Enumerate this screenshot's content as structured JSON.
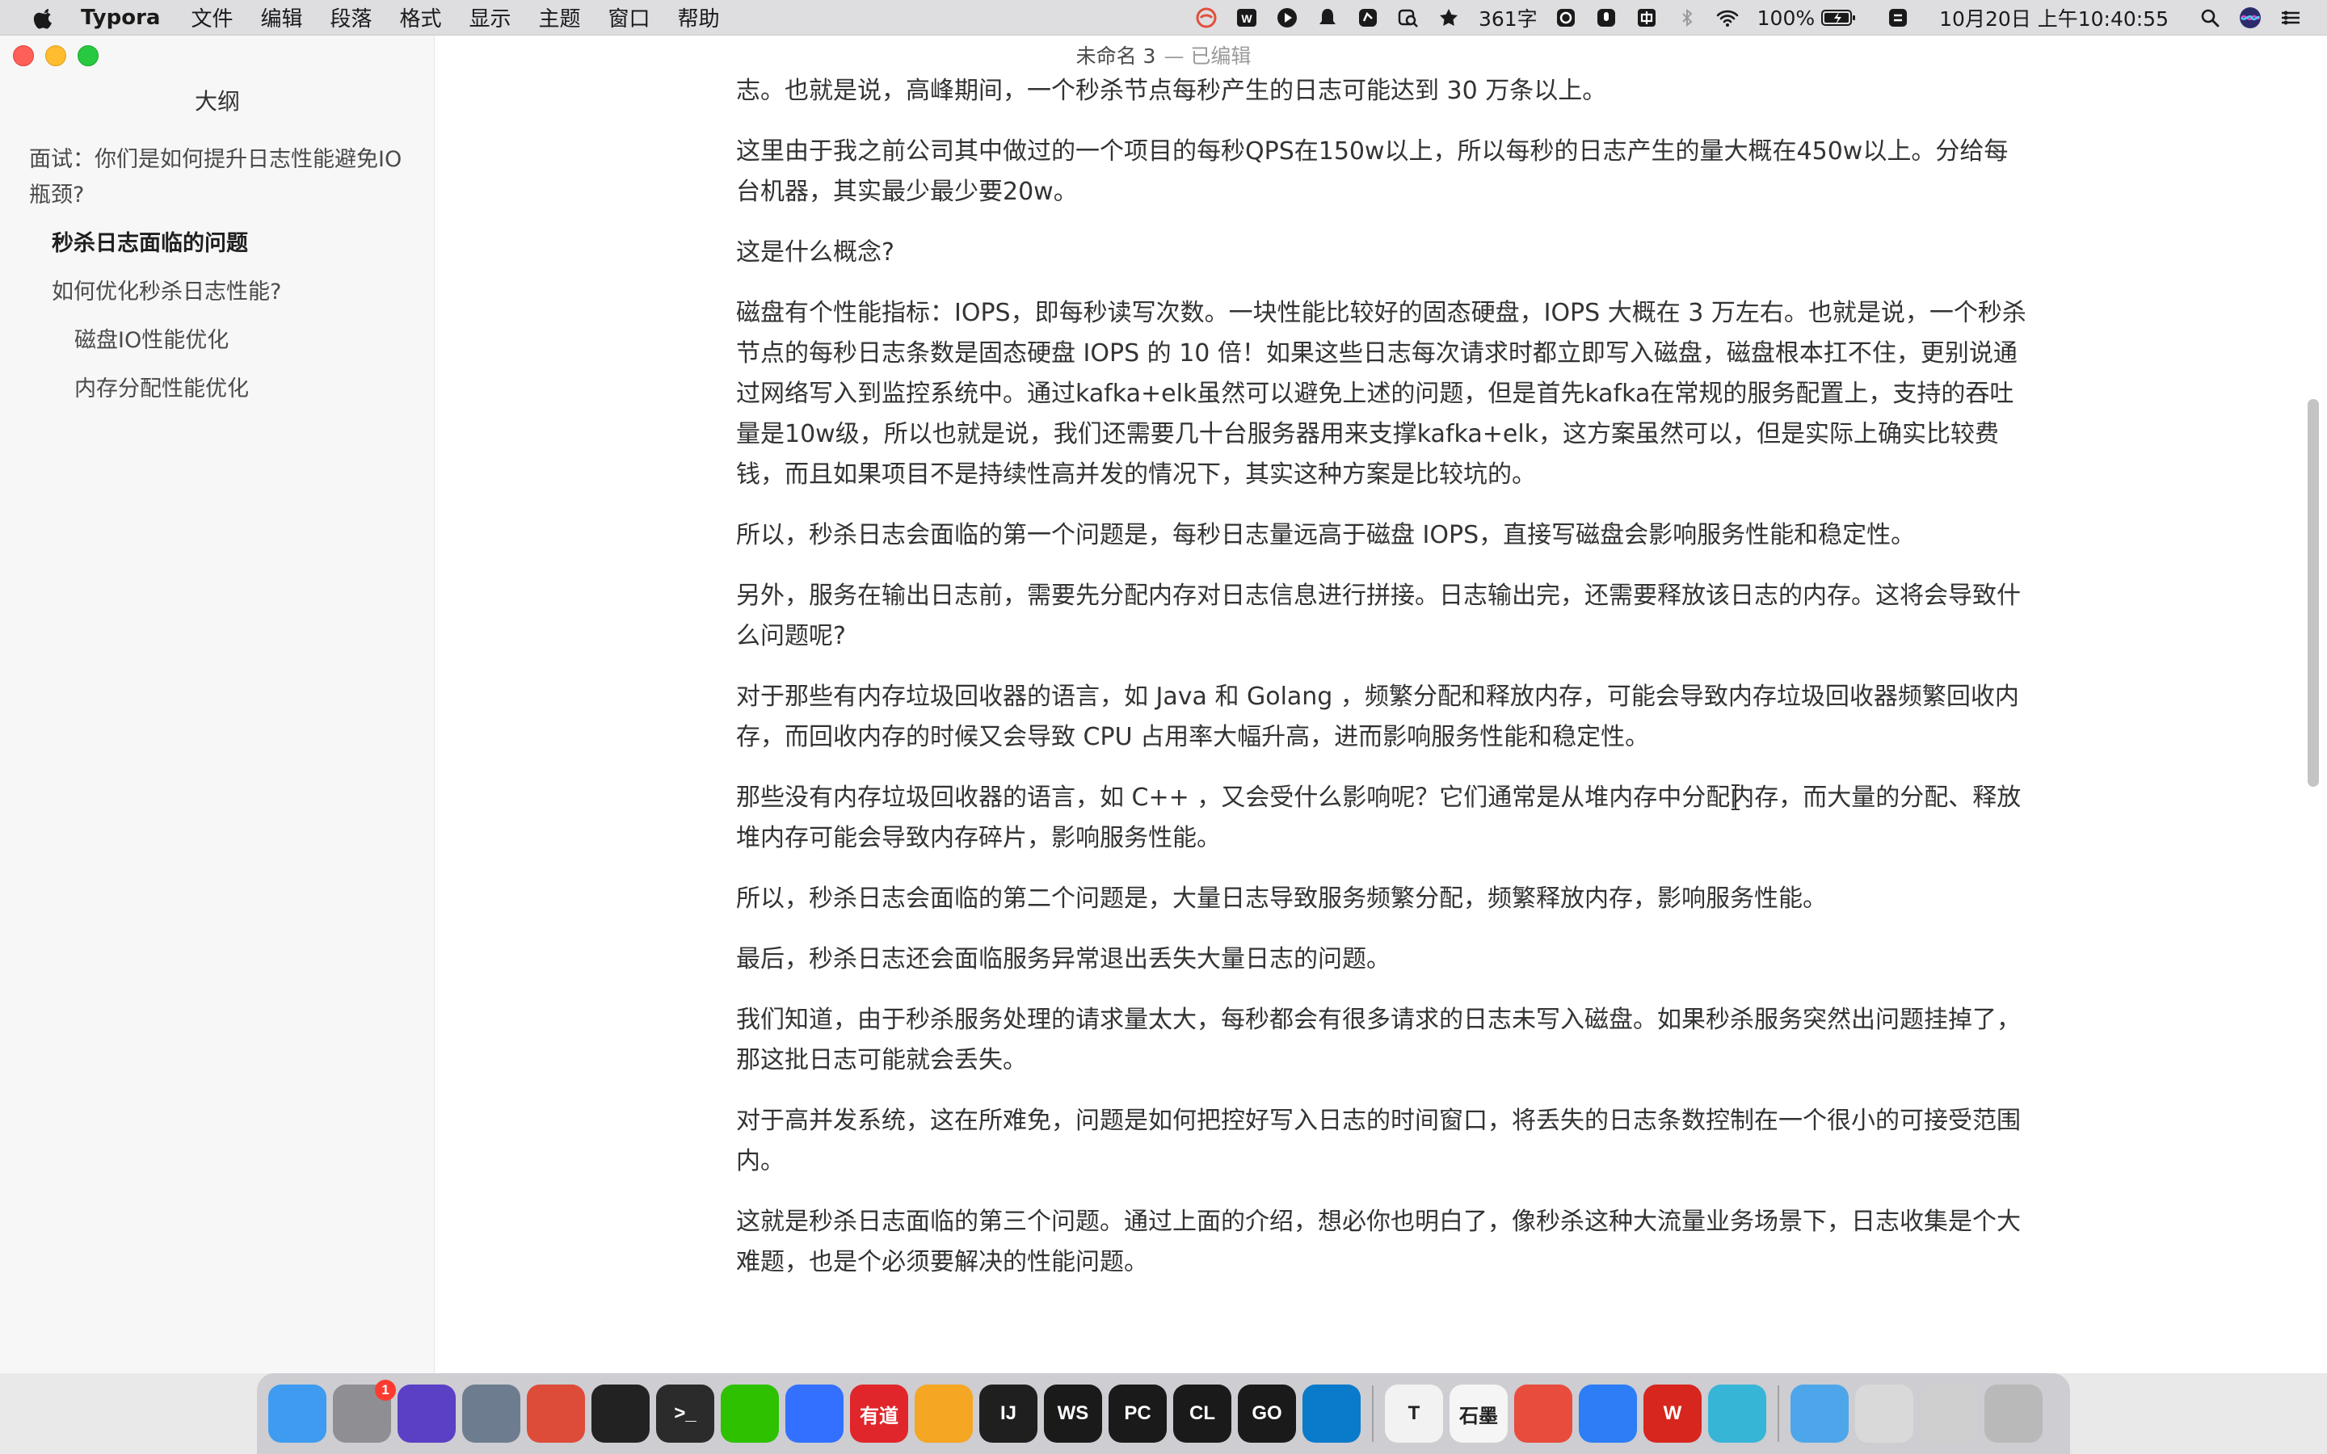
{
  "menubar": {
    "app_name": "Typora",
    "items": [
      "文件",
      "编辑",
      "段落",
      "格式",
      "显示",
      "主题",
      "窗口",
      "帮助"
    ],
    "status": {
      "word_count": "361字",
      "battery": "100%",
      "datetime": "10月20日 上午10:40:55"
    },
    "status_icons": [
      "typora-icon",
      "wps-icon",
      "play-icon",
      "qq-bell-icon",
      "screenshot-icon",
      "search-doc-icon",
      "star-icon",
      "wechat-icon",
      "mic-icon",
      "input-method-icon",
      "bluetooth-icon",
      "wifi-icon",
      "battery-icon",
      "sync-icon",
      "spotlight-icon",
      "siri-icon",
      "control-center-icon"
    ]
  },
  "window": {
    "title": "未命名 3",
    "status": "— 已编辑"
  },
  "sidebar": {
    "heading": "大纲",
    "outline": [
      {
        "label": "面试：你们是如何提升日志性能避免IO 瓶颈?",
        "level": 1,
        "active": false
      },
      {
        "label": "秒杀日志面临的问题",
        "level": 2,
        "active": true
      },
      {
        "label": "如何优化秒杀日志性能?",
        "level": 2,
        "active": false
      },
      {
        "label": "磁盘IO性能优化",
        "level": 3,
        "active": false
      },
      {
        "label": "内存分配性能优化",
        "level": 3,
        "active": false
      }
    ]
  },
  "document": {
    "paragraphs": [
      "志。也就是说，高峰期间，一个秒杀节点每秒产生的日志可能达到 30 万条以上。",
      "这里由于我之前公司其中做过的一个项目的每秒QPS在150w以上，所以每秒的日志产生的量大概在450w以上。分给每台机器，其实最少最少要20w。",
      "这是什么概念?",
      "磁盘有个性能指标：IOPS，即每秒读写次数。一块性能比较好的固态硬盘，IOPS 大概在 3 万左右。也就是说，一个秒杀节点的每秒日志条数是固态硬盘 IOPS 的 10 倍！如果这些日志每次请求时都立即写入磁盘，磁盘根本扛不住，更别说通过网络写入到监控系统中。通过kafka+elk虽然可以避免上述的问题，但是首先kafka在常规的服务配置上，支持的吞吐量是10w级，所以也就是说，我们还需要几十台服务器用来支撑kafka+elk，这方案虽然可以，但是实际上确实比较费钱，而且如果项目不是持续性高并发的情况下，其实这种方案是比较坑的。",
      "所以，秒杀日志会面临的第一个问题是，每秒日志量远高于磁盘 IOPS，直接写磁盘会影响服务性能和稳定性。",
      "另外，服务在输出日志前，需要先分配内存对日志信息进行拼接。日志输出完，还需要释放该日志的内存。这将会导致什么问题呢?",
      "对于那些有内存垃圾回收器的语言，如 Java 和 Golang ，频繁分配和释放内存，可能会导致内存垃圾回收器频繁回收内存，而回收内存的时候又会导致 CPU 占用率大幅升高，进而影响服务性能和稳定性。",
      "那些没有内存垃圾回收器的语言，如 C++ ，又会受什么影响呢？它们通常是从堆内存中分配内存，而大量的分配、释放堆内存可能会导致内存碎片，影响服务性能。",
      "所以，秒杀日志会面临的第二个问题是，大量日志导致服务频繁分配，频繁释放内存，影响服务性能。",
      "最后，秒杀日志还会面临服务异常退出丢失大量日志的问题。",
      "我们知道，由于秒杀服务处理的请求量太大，每秒都会有很多请求的日志未写入磁盘。如果秒杀服务突然出问题挂掉了，那这批日志可能就会丢失。",
      "对于高并发系统，这在所难免，问题是如何把控好写入日志的时间窗口，将丢失的日志条数控制在一个很小的可接受范围内。",
      "这就是秒杀日志面临的第三个问题。通过上面的介绍，想必你也明白了，像秒杀这种大流量业务场景下，日志收集是个大难题，也是个必须要解决的性能问题。"
    ]
  },
  "dock": {
    "apps": [
      {
        "name": "finder",
        "label": "",
        "color": "#3f9bf0"
      },
      {
        "name": "system-preferences",
        "label": "",
        "color": "#8e8e93",
        "badge": "1"
      },
      {
        "name": "siri",
        "label": "",
        "color": "#5b3fc4"
      },
      {
        "name": "launchpad",
        "label": "",
        "color": "#6d7d8f"
      },
      {
        "name": "chrome",
        "label": "",
        "color": "#dd4b39"
      },
      {
        "name": "qq",
        "label": "",
        "color": "#222222"
      },
      {
        "name": "terminal",
        "label": ">_",
        "color": "#2b2b2b"
      },
      {
        "name": "wechat",
        "label": "",
        "color": "#2dc100"
      },
      {
        "name": "feishu",
        "label": "",
        "color": "#3370ff"
      },
      {
        "name": "youdao",
        "label": "有道",
        "color": "#e0262b"
      },
      {
        "name": "pycharm-ce",
        "label": "",
        "color": "#f5a623"
      },
      {
        "name": "intellij",
        "label": "IJ",
        "color": "#1f1f1f"
      },
      {
        "name": "webstorm",
        "label": "WS",
        "color": "#1a1a1a"
      },
      {
        "name": "pycharm",
        "label": "PC",
        "color": "#1a1a1a"
      },
      {
        "name": "clion",
        "label": "CL",
        "color": "#1a1a1a"
      },
      {
        "name": "goland",
        "label": "GO",
        "color": "#1a1a1a"
      },
      {
        "name": "vscode",
        "label": "",
        "color": "#0a7acb"
      },
      {
        "name": "typora",
        "label": "T",
        "color": "#f2f2f2"
      },
      {
        "name": "shimo",
        "label": "石墨",
        "color": "#f5f5f5"
      },
      {
        "name": "color-picker",
        "label": "",
        "color": "#e84c3d"
      },
      {
        "name": "baidu-netdisk",
        "label": "",
        "color": "#2c7df6"
      },
      {
        "name": "wps",
        "label": "W",
        "color": "#d7261e"
      },
      {
        "name": "network-tool",
        "label": "",
        "color": "#37b5d6"
      },
      {
        "name": "downloads",
        "label": "",
        "color": "#4ea6ea"
      },
      {
        "name": "recent-docs",
        "label": "",
        "color": "#d9d9d9"
      },
      {
        "name": "screenshots",
        "label": "",
        "color": "#cfcfcf"
      },
      {
        "name": "trash",
        "label": "",
        "color": "#b9b9b9"
      }
    ]
  }
}
